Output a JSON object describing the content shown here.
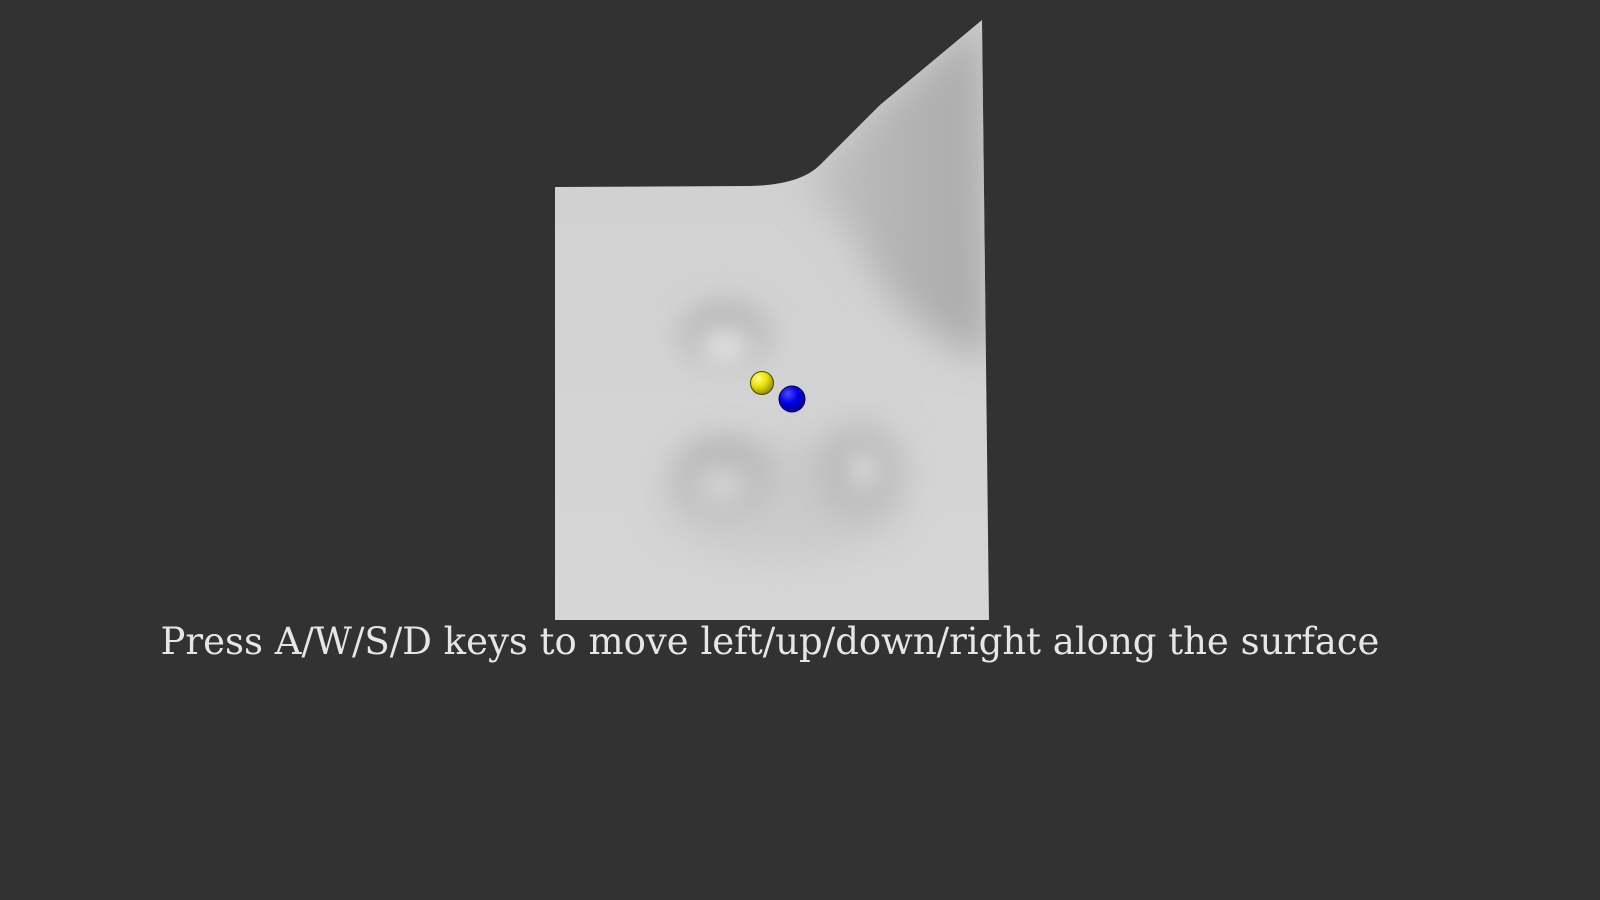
{
  "instructions": {
    "text": "Press A/W/S/D keys to move left/up/down/right along the surface"
  },
  "colors": {
    "background": "#323232",
    "surface": "#d3d3d3",
    "player_ball": "#0000e6",
    "target_ball": "#e6e000",
    "text": "#e6e6e6"
  },
  "objects": {
    "surface": "shaded 3d surface plot with bumps and a raised back-right corner",
    "player": "blue-sphere",
    "target": "yellow-sphere"
  }
}
